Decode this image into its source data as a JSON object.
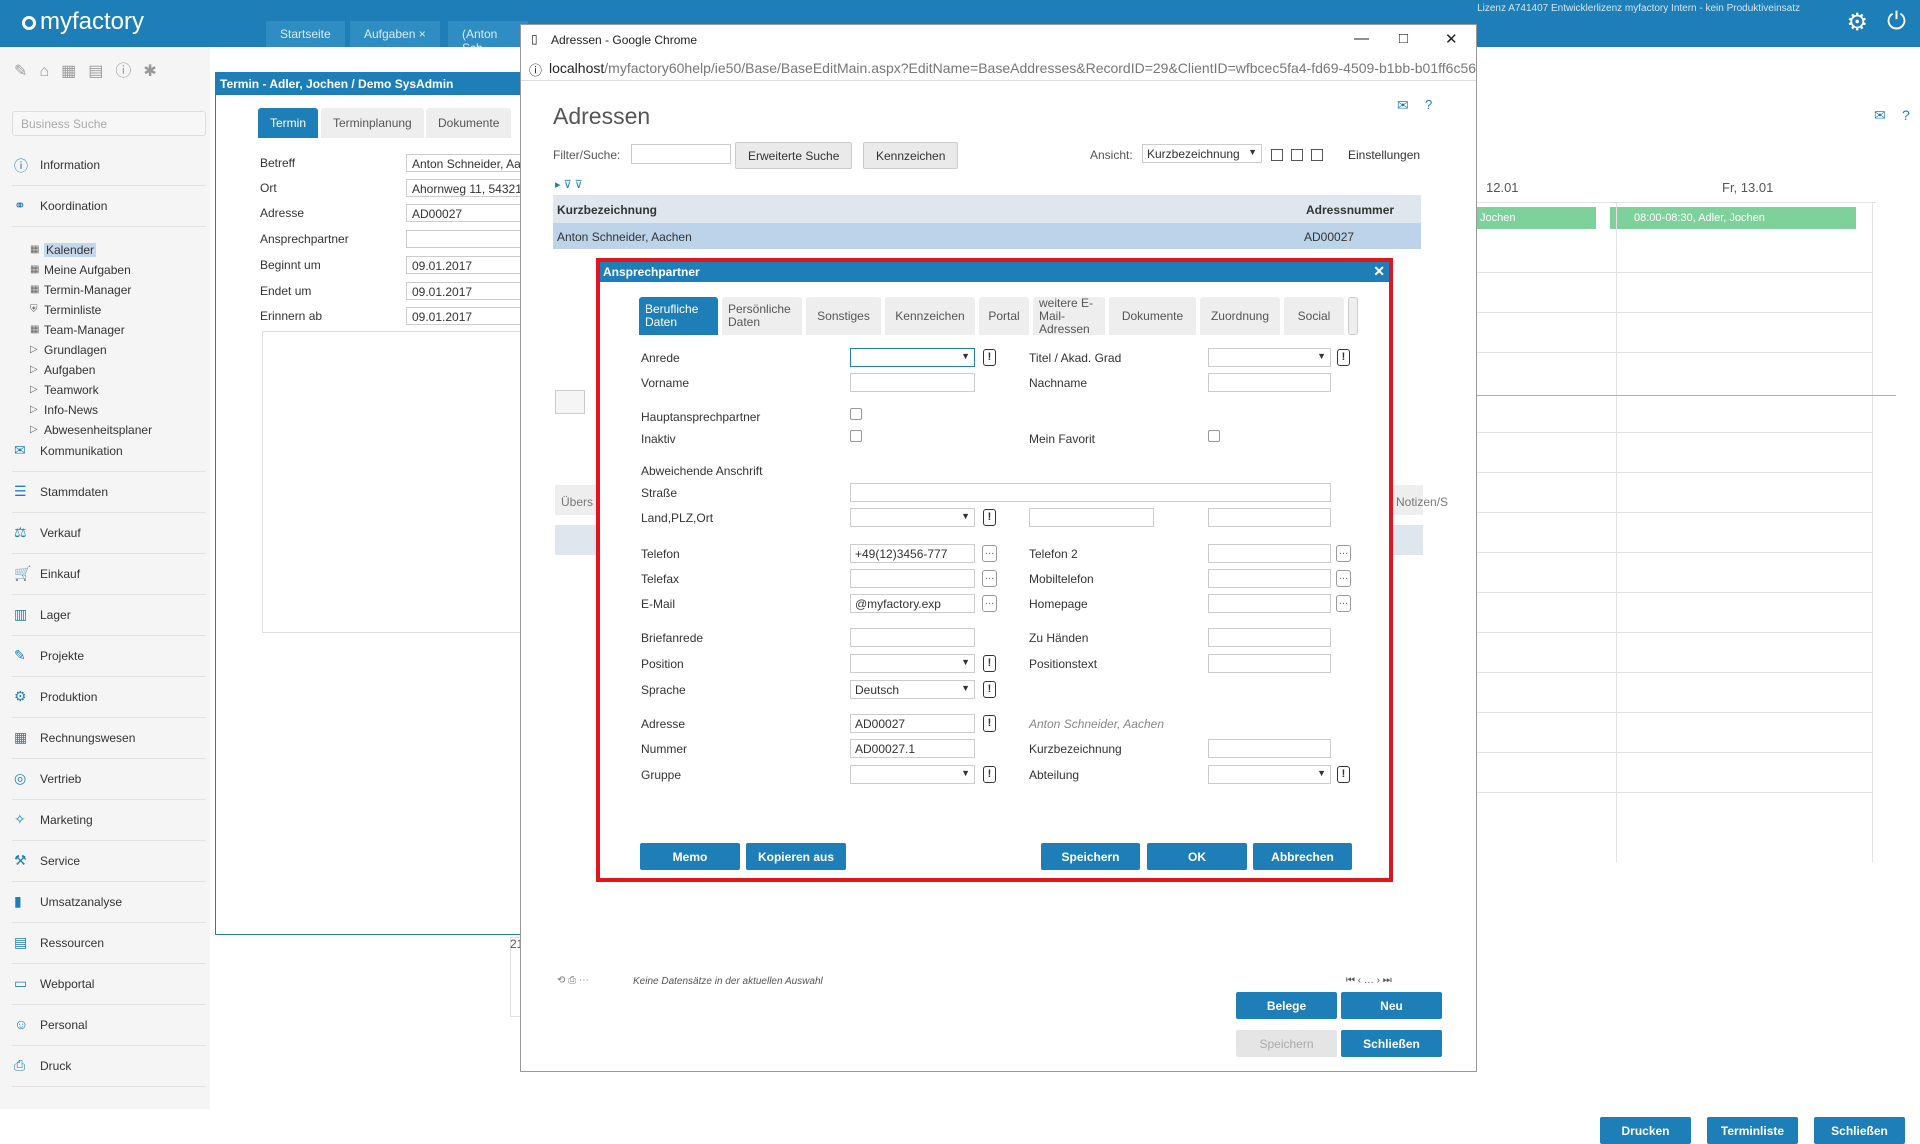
{
  "app": {
    "logo": "myfactory",
    "license": "Lizenz A741407 Entwicklerlizenz myfactory Intern - kein Produktiveinsatz",
    "tabs": [
      "Startseite",
      "Aufgaben",
      "(Anton Sch"
    ],
    "search_placeholder": "Business Suche"
  },
  "sidebar": {
    "nav": [
      "Information",
      "Koordination",
      "Kommunikation",
      "Stammdaten",
      "Verkauf",
      "Einkauf",
      "Lager",
      "Projekte",
      "Produktion",
      "Rechnungswesen",
      "Vertrieb",
      "Marketing",
      "Service",
      "Umsatzanalyse",
      "Ressourcen",
      "Webportal",
      "Personal",
      "Druck"
    ],
    "sub": [
      "Kalender",
      "Meine Aufgaben",
      "Termin-Manager",
      "Terminliste",
      "Team-Manager",
      "Grundlagen",
      "Aufgaben",
      "Teamwork",
      "Info-News",
      "Abwesenheitsplaner"
    ]
  },
  "calendar": {
    "day1": "12.01",
    "day2": "Fr, 13.01",
    "event1": "Jochen",
    "event2": "08:00-08:30, Adler, Jochen",
    "notizen": "Notizen/S",
    "uebers": "Übers",
    "bottom_buttons": [
      "Drucken",
      "Terminliste",
      "Schließen"
    ],
    "row_no": "21"
  },
  "termin": {
    "title": "Termin - Adler, Jochen / Demo SysAdmin",
    "tabs": [
      "Termin",
      "Terminplanung",
      "Dokumente"
    ],
    "labels": [
      "Betreff",
      "Ort",
      "Adresse",
      "Ansprechpartner",
      "Beginnt um",
      "Endet um",
      "Erinnern ab"
    ],
    "values": [
      "Anton Schneider, Aa",
      "Ahornweg 11, 54321",
      "AD00027",
      "",
      "09.01.2017",
      "09.01.2017",
      "09.01.2017"
    ]
  },
  "chrome": {
    "title": "Adressen - Google Chrome",
    "url_host": "localhost",
    "url_rest": "/myfactory60help/ie50/Base/BaseEditMain.aspx?EditName=BaseAddresses&RecordID=29&ClientID=wfbcec5fa4-fd69-4509-b1bb-b01ff6c56",
    "page_title": "Adressen",
    "filter_label": "Filter/Suche:",
    "btn_erweiterte": "Erweiterte Suche",
    "btn_kennzeichen": "Kennzeichen",
    "ansicht_label": "Ansicht:",
    "ansicht_value": "Kurzbezeichnung",
    "einstellungen": "Einstellungen",
    "col1": "Kurzbezeichnung",
    "col2": "Adressnummer",
    "row_name": "Anton Schneider, Aachen",
    "row_no": "AD00027",
    "status": "Keine Datensätze in der aktuellen Auswahl",
    "btn_belege": "Belege",
    "btn_neu": "Neu",
    "btn_speichern": "Speichern",
    "btn_schliessen": "Schließen"
  },
  "dialog": {
    "title": "Ansprechpartner",
    "tabs": [
      "Berufliche Daten",
      "Persönliche Daten",
      "Sonstiges",
      "Kennzeichen",
      "Portal",
      "weitere E-Mail-Adressen",
      "Dokumente",
      "Zuordnung",
      "Social"
    ],
    "labels": {
      "anrede": "Anrede",
      "titel": "Titel / Akad. Grad",
      "vorname": "Vorname",
      "nachname": "Nachname",
      "haupt": "Hauptansprechpartner",
      "inaktiv": "Inaktiv",
      "favorit": "Mein Favorit",
      "abweichend": "Abweichende Anschrift",
      "strasse": "Straße",
      "land": "Land,PLZ,Ort",
      "telefon": "Telefon",
      "telefon2": "Telefon 2",
      "telefax": "Telefax",
      "mobil": "Mobiltelefon",
      "email": "E-Mail",
      "homepage": "Homepage",
      "briefanrede": "Briefanrede",
      "zuhaenden": "Zu Händen",
      "position": "Position",
      "positionstext": "Positionstext",
      "sprache": "Sprache",
      "adresse": "Adresse",
      "nummer": "Nummer",
      "kurzbez": "Kurzbezeichnung",
      "gruppe": "Gruppe",
      "abteilung": "Abteilung"
    },
    "values": {
      "telefon": "+49(12)3456-777",
      "email": "@myfactory.exp",
      "sprache": "Deutsch",
      "adresse": "AD00027",
      "adresse_name": "Anton Schneider, Aachen",
      "nummer": "AD00027.1"
    },
    "buttons": {
      "memo": "Memo",
      "kopieren": "Kopieren aus",
      "speichern": "Speichern",
      "ok": "OK",
      "abbrechen": "Abbrechen"
    }
  }
}
